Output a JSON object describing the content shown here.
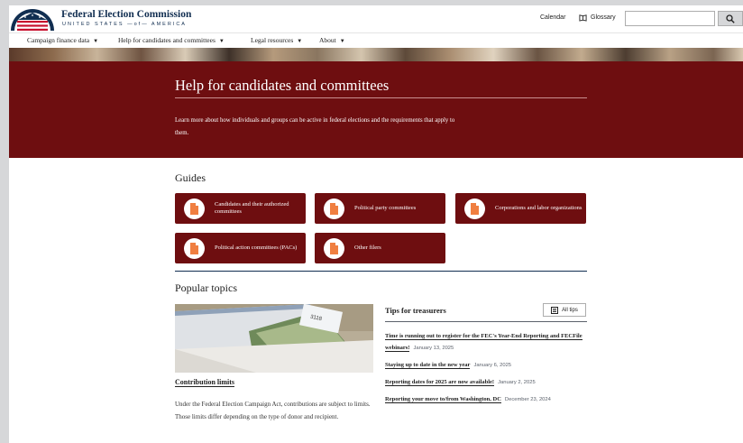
{
  "colors": {
    "brand_navy": "#112e51",
    "hero_maroon": "#6e0e10",
    "accent_orange": "#f07f41"
  },
  "header": {
    "brand_title": "Federal Election Commission",
    "brand_subtitle": "UNITED STATES —of— AMERICA",
    "calendar_label": "Calendar",
    "glossary_label": "Glossary",
    "search_placeholder": ""
  },
  "nav": {
    "items": [
      {
        "label": "Campaign finance data"
      },
      {
        "label": "Help for candidates and committees"
      },
      {
        "label": "Legal resources"
      },
      {
        "label": "About"
      }
    ]
  },
  "hero": {
    "title": "Help for candidates and committees",
    "intro": "Learn more about how individuals and groups can be active in federal elections and the requirements that apply to them."
  },
  "guides": {
    "heading": "Guides",
    "items": [
      {
        "label": "Candidates and their authorized committees",
        "icon": "document-icon"
      },
      {
        "label": "Political party committees",
        "icon": "document-icon"
      },
      {
        "label": "Corporations and labor organizations",
        "icon": "document-icon"
      },
      {
        "label": "Political action committees (PACs)",
        "icon": "document-icon"
      },
      {
        "label": "Other filers",
        "icon": "document-icon"
      }
    ]
  },
  "popular": {
    "heading": "Popular topics",
    "feature": {
      "title": "Contribution limits",
      "description": "Under the Federal Election Campaign Act, contributions are subject to limits. Those limits differ depending on the type of donor and recipient."
    },
    "tips": {
      "heading": "Tips for treasurers",
      "all_label": "All tips",
      "items": [
        {
          "title": "Time is running out to register for the FEC's Year-End Reporting and FECFile webinars!",
          "date": "January 13, 2025"
        },
        {
          "title": "Staying up to date in the new year",
          "date": "January 6, 2025"
        },
        {
          "title": "Reporting dates for 2025 are now available!",
          "date": "January 2, 2025"
        },
        {
          "title": "Reporting your move to/from Washington, DC",
          "date": "December 23, 2024"
        }
      ]
    }
  }
}
